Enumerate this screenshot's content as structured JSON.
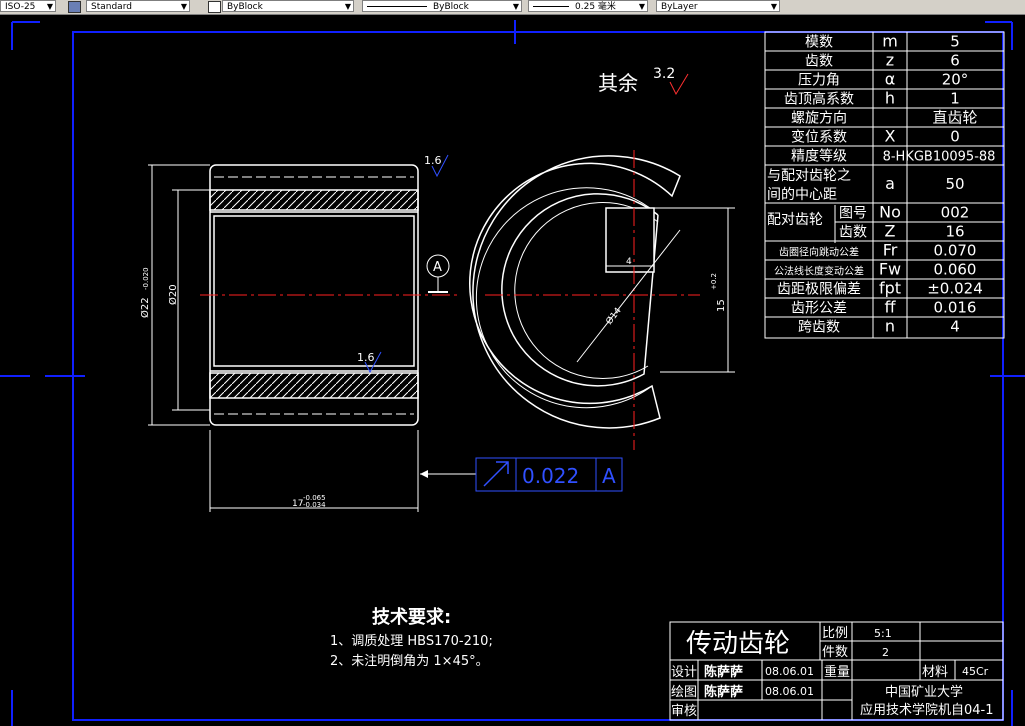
{
  "toolbar": {
    "dimstyle": "ISO-25",
    "textstyle": "Standard",
    "color": "ByBlock",
    "linetype": "ByBlock",
    "lineweight": "0.25 毫米",
    "plotstyle": "ByLayer"
  },
  "drawing": {
    "surface_finish_label": "其余",
    "surface_finish_value": "3.2",
    "roughness_1": "1.6",
    "roughness_2": "1.6",
    "datum": "A",
    "tolerance_value": "0.022",
    "tolerance_datum": "A",
    "dim_outer": "Ø22",
    "dim_outer_tol": "-0.020",
    "dim_inner": "Ø20",
    "dim_length": "17",
    "dim_length_tol_top": "-0.065",
    "dim_length_tol_bot": "-0.034",
    "dim_keyway_width": "4",
    "dim_bore": "Ø14",
    "dim_keyway_depth": "15",
    "dim_keyway_depth_tol": "+0.2",
    "tech_title": "技术要求:",
    "tech_line_1": "1、调质处理 HBS170-210;",
    "tech_line_2": "2、未注明倒角为 1×45°。"
  },
  "param_table": [
    {
      "name": "模数",
      "sym": "m",
      "val": "5"
    },
    {
      "name": "齿数",
      "sym": "z",
      "val": "6"
    },
    {
      "name": "压力角",
      "sym": "α",
      "val": "20°"
    },
    {
      "name": "齿顶高系数",
      "sym": "h",
      "val": "1"
    },
    {
      "name": "螺旋方向",
      "sym": "",
      "val": "直齿轮"
    },
    {
      "name": "变位系数",
      "sym": "X",
      "val": "0"
    },
    {
      "name": "精度等级",
      "sym": "",
      "val": "8-HKGB10095-88"
    },
    {
      "name": "与配对齿轮之",
      "name2": "间的中心距",
      "sym": "a",
      "val": "50"
    },
    {
      "name": "配对齿轮",
      "sub": "图号",
      "sym": "No",
      "val": "002"
    },
    {
      "name": "",
      "sub": "齿数",
      "sym": "Z",
      "val": "16"
    },
    {
      "name": "齿圈径向跳动公差",
      "sym": "Fr",
      "val": "0.070"
    },
    {
      "name": "公法线长度变动公差",
      "sym": "Fw",
      "val": "0.060"
    },
    {
      "name": "齿距极限偏差",
      "sym": "fpt",
      "val": "±0.024"
    },
    {
      "name": "齿形公差",
      "sym": "ff",
      "val": "0.016"
    },
    {
      "name": "跨齿数",
      "sym": "n",
      "val": "4"
    }
  ],
  "title_block": {
    "part_name": "传动齿轮",
    "scale_label": "比例",
    "scale_value": "5:1",
    "qty_label": "件数",
    "qty_value": "2",
    "design_label": "设计",
    "designer": "陈萨萨",
    "design_date": "08.06.01",
    "weight_label": "重量",
    "material_label": "材料",
    "material_value": "45Cr",
    "draw_label": "绘图",
    "drawer": "陈萨萨",
    "draw_date": "08.06.01",
    "school_1": "中国矿业大学",
    "school_2": "应用技术学院机自04-1",
    "review_label": "审核"
  },
  "colors": {
    "line": "#ffffff",
    "center": "#ff2020",
    "border": "#1020ff",
    "dim": "#ffffff",
    "tolerance": "#3050ff",
    "roughness": "#ff3030"
  }
}
